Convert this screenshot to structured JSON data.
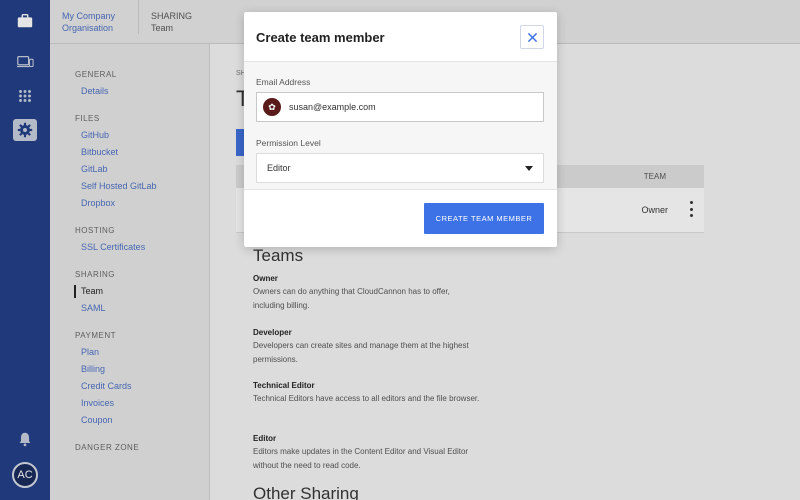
{
  "colors": {
    "rail": "#1f3c86",
    "accent": "#3d72e6",
    "link": "#4b6fc4"
  },
  "rail": {
    "icons": [
      "briefcase-icon",
      "devices-icon",
      "grid-icon",
      "gear-icon",
      "bell-icon"
    ],
    "avatar_initials": "AC"
  },
  "breadcrumb": {
    "org_line1": "My Company",
    "org_line2": "Organisation",
    "section_line1": "SHARING",
    "section_line2": "Team"
  },
  "sidenav": {
    "groups": [
      {
        "heading": "GENERAL",
        "items": [
          "Details"
        ]
      },
      {
        "heading": "FILES",
        "items": [
          "GitHub",
          "Bitbucket",
          "GitLab",
          "Self Hosted GitLab",
          "Dropbox"
        ]
      },
      {
        "heading": "HOSTING",
        "items": [
          "SSL Certificates"
        ]
      },
      {
        "heading": "SHARING",
        "items": [
          "Team",
          "SAML"
        ]
      },
      {
        "heading": "PAYMENT",
        "items": [
          "Plan",
          "Billing",
          "Credit Cards",
          "Invoices",
          "Coupon"
        ]
      },
      {
        "heading": "DANGER ZONE",
        "items": []
      }
    ],
    "active_item": "Team"
  },
  "main": {
    "small_label": "SH",
    "big_letter": "T",
    "table_header_team": "TEAM",
    "row_role": "Owner",
    "teams_title": "Teams",
    "roles": [
      {
        "name": "Owner",
        "desc": "Owners can do anything that CloudCannon has to offer, including billing."
      },
      {
        "name": "Developer",
        "desc": "Developers can create sites and manage them at the highest permissions."
      },
      {
        "name": "Technical Editor",
        "desc": "Technical Editors have access to all editors and the file browser."
      },
      {
        "name": "Editor",
        "desc": "Editors make updates in the Content Editor and Visual Editor without the need to read code."
      }
    ],
    "other_sharing_title": "Other Sharing"
  },
  "modal": {
    "title": "Create team member",
    "email_label": "Email Address",
    "email_value": "susan@example.com",
    "permission_label": "Permission Level",
    "permission_value": "Editor",
    "submit_label": "CREATE TEAM MEMBER"
  }
}
